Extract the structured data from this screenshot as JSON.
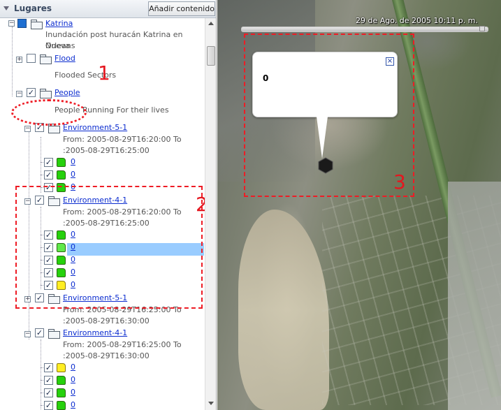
{
  "panel": {
    "title": "Lugares",
    "add_button": "Añadir contenido"
  },
  "tree": {
    "root": {
      "label": "Katrina",
      "desc_line1": "Inundación post huracán Katrina en Nueva",
      "desc_line2": "Orleans"
    },
    "flood": {
      "label": "Flood",
      "desc": "Flooded Sectors"
    },
    "people": {
      "label": "People",
      "desc": "People Running For their lives"
    },
    "groups": [
      {
        "label": "Environment-5-1",
        "from": "From: 2005-08-29T16:20:00 To",
        "to": ":2005-08-29T16:25:00",
        "items": [
          "0",
          "0",
          "0"
        ]
      },
      {
        "label": "Environment-4-1",
        "from": "From: 2005-08-29T16:20:00 To",
        "to": ":2005-08-29T16:25:00",
        "items": [
          "0",
          "0",
          "0",
          "0",
          "0"
        ]
      },
      {
        "label": "Environment-5-1",
        "from": "From: 2005-08-29T16:25:00 To",
        "to": ":2005-08-29T16:30:00",
        "items": []
      },
      {
        "label": "Environment-4-1",
        "from": "From: 2005-08-29T16:25:00 To",
        "to": ":2005-08-29T16:30:00",
        "items": [
          "0",
          "0",
          "0",
          "0"
        ]
      }
    ]
  },
  "map": {
    "time_label": "29 de Ago. de 2005  10:11 p. m.",
    "balloon_text": "0",
    "balloon_close": "×"
  },
  "annotations": {
    "one": "1",
    "two": "2",
    "three": "3"
  },
  "colors": {
    "annotation": "#ee1c25",
    "selection": "#99ccff",
    "link": "#0b2ccf",
    "cube_green": "#26d10c",
    "cube_yellow": "#ffee22"
  }
}
